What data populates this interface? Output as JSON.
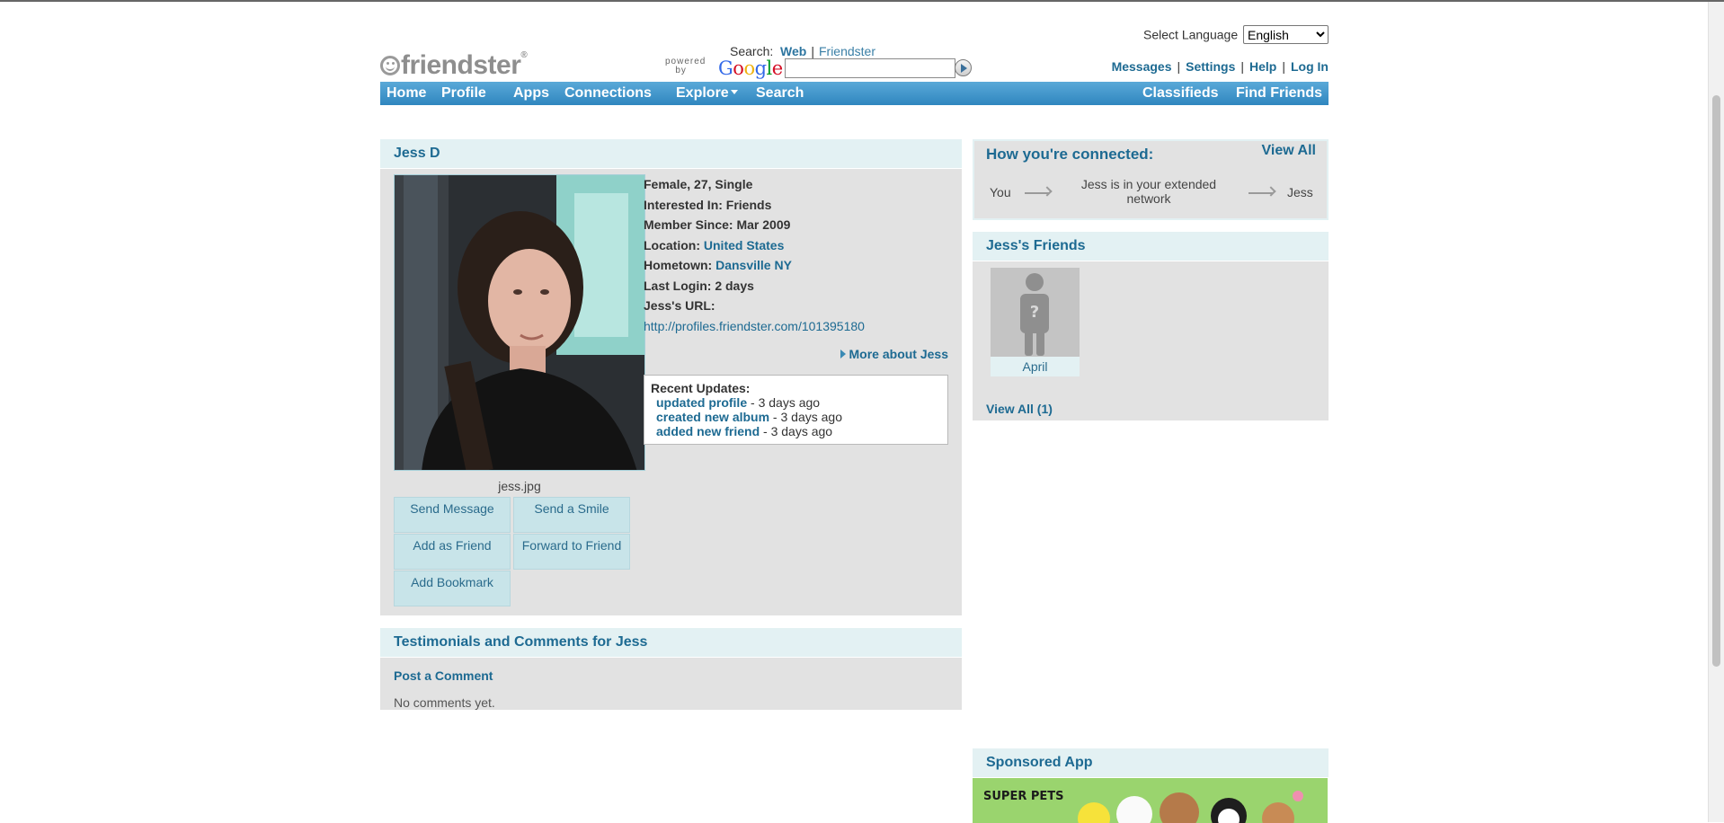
{
  "header": {
    "select_language_label": "Select Language",
    "language_value": "English",
    "logo_text": "friendster",
    "search_label": "Search:",
    "search_web": "Web",
    "search_friendster": "Friendster",
    "powered_by": "powered by",
    "google_word": "Google",
    "search_placeholder": "",
    "links": {
      "messages": "Messages",
      "settings": "Settings",
      "help": "Help",
      "login": "Log In"
    }
  },
  "nav": {
    "home": "Home",
    "profile": "Profile",
    "apps": "Apps",
    "connections": "Connections",
    "explore": "Explore",
    "search": "Search",
    "classifieds": "Classifieds",
    "find_friends": "Find Friends"
  },
  "profile": {
    "name": "Jess D",
    "photo_caption": "jess.jpg",
    "details": {
      "summary": "Female, 27, Single",
      "interested_label": "Interested In:",
      "interested_value": "Friends",
      "member_label": "Member Since:",
      "member_value": "Mar 2009",
      "location_label": "Location:",
      "location_value": "United States",
      "hometown_label": "Hometown:",
      "hometown_value": "Dansville NY",
      "last_login_label": "Last Login:",
      "last_login_value": "2 days",
      "url_label": "Jess's URL:",
      "url_value": "http://profiles.friendster.com/101395180"
    },
    "more_link": "More about Jess",
    "actions": {
      "send_message": "Send Message",
      "send_smile": "Send a Smile",
      "add_friend": "Add as Friend",
      "forward": "Forward to Friend",
      "bookmark": "Add Bookmark"
    },
    "updates": {
      "title": "Recent Updates:",
      "items": [
        {
          "link": "updated profile",
          "time": " - 3 days ago"
        },
        {
          "link": "created new album",
          "time": " - 3 days ago"
        },
        {
          "link": "added new friend",
          "time": " - 3 days ago"
        }
      ]
    }
  },
  "comments": {
    "title": "Testimonials and Comments for Jess",
    "post_link": "Post a Comment",
    "empty_text": "No comments yet."
  },
  "connection": {
    "title": "How you're connected:",
    "view_all": "View All",
    "you": "You",
    "middle": "Jess is in your extended network",
    "end": "Jess"
  },
  "friends": {
    "title": "Jess's Friends",
    "items": [
      {
        "name": "April"
      }
    ],
    "view_all": "View All (1)"
  },
  "sponsored": {
    "title": "Sponsored App",
    "ad_text": "SUPER PETS"
  }
}
